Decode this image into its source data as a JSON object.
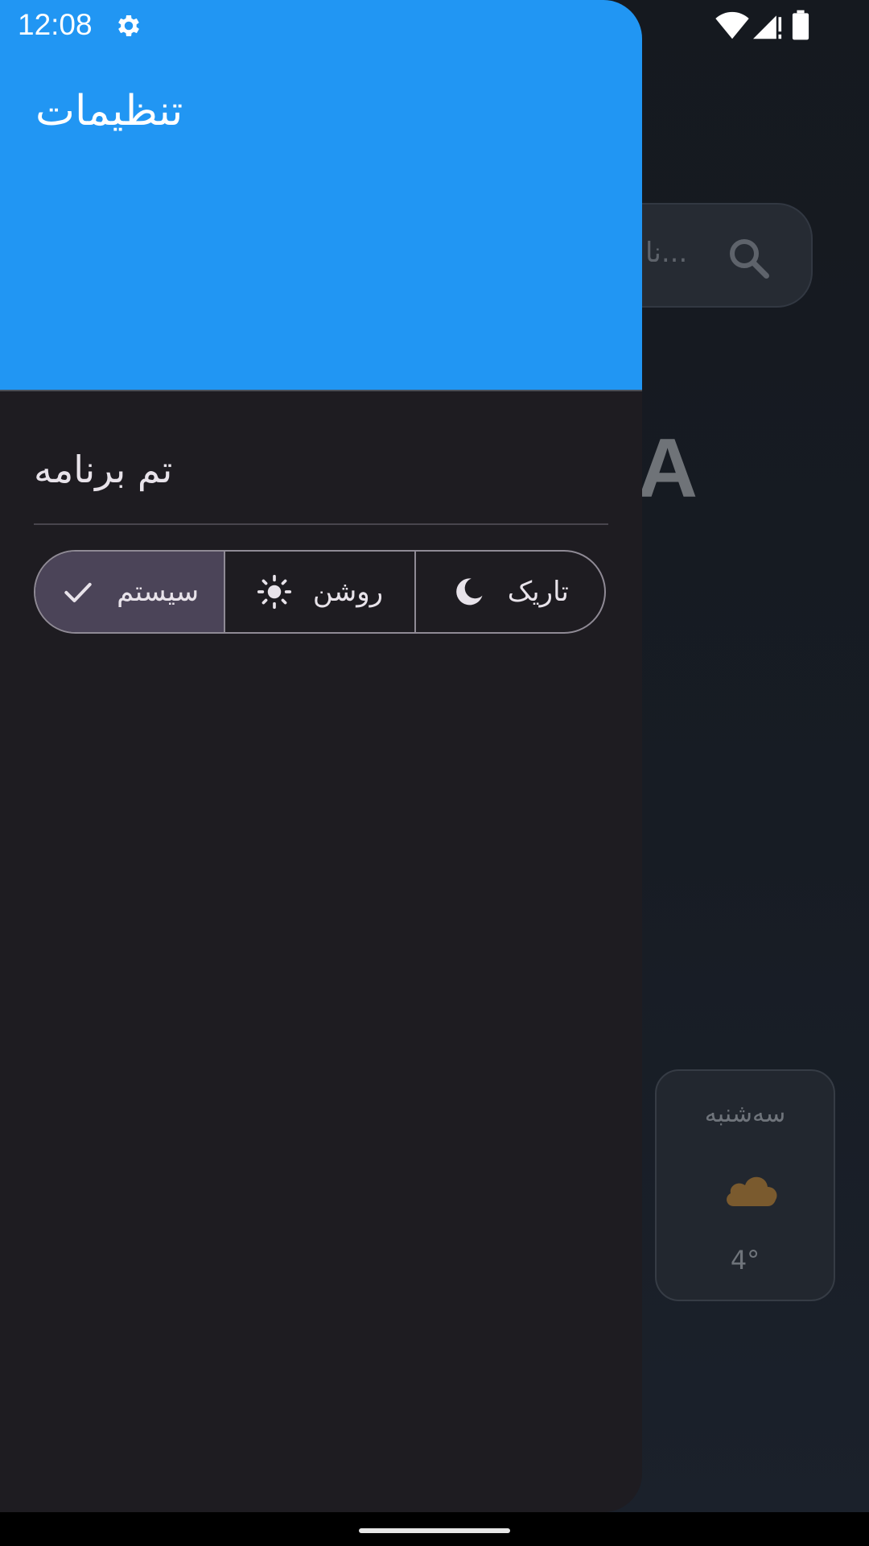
{
  "status_bar": {
    "time": "12:08",
    "icons": [
      "settings-icon",
      "wifi-icon",
      "signal-icon",
      "battery-icon"
    ]
  },
  "background_app": {
    "search": {
      "placeholder": "...نا",
      "icon": "search-icon"
    },
    "city_partial": "A",
    "forecast_card": {
      "day": "سه‌شنبه",
      "icon": "cloud-icon",
      "temperature": "4°"
    }
  },
  "drawer": {
    "header_title": "تنظیمات",
    "section_title": "تم برنامه",
    "theme_options": [
      {
        "label": "سیستم",
        "icon": "check-icon",
        "selected": true
      },
      {
        "label": "روشن",
        "icon": "sun-icon",
        "selected": false
      },
      {
        "label": "تاریک",
        "icon": "moon-icon",
        "selected": false
      }
    ]
  },
  "colors": {
    "header_blue": "#2196f3",
    "drawer_surface": "#1e1c21",
    "selected_segment": "#4b4458",
    "outline": "#8f8a95",
    "forecast_cloud": "#7a5a2e"
  }
}
